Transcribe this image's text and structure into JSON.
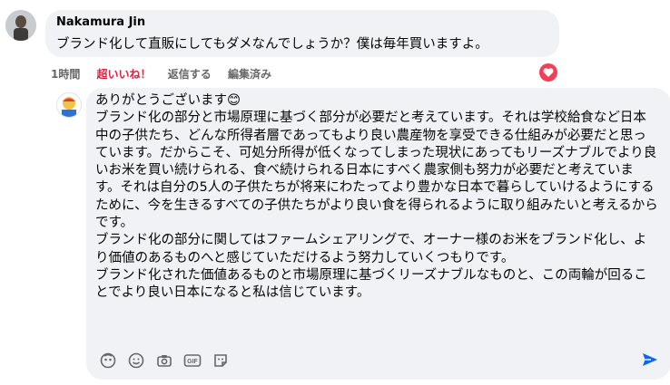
{
  "comment": {
    "author": "Nakamura Jin",
    "text": "ブランド化して直販にしてもダメなんでしょうか？僕は毎年買いますよ。",
    "time": "1時間",
    "like_label": "超いいね！",
    "reply_label": "返信する",
    "edited_label": "編集済み"
  },
  "reply_draft": {
    "text": "ありがとうございます😊\nブランド化の部分と市場原理に基づく部分が必要だと考えています。それは学校給食など日本中の子供たち、どんな所得者層であってもより良い農産物を享受できる仕組みが必要だと思っています。だからこそ、可処分所得が低くなってしまった現状にあってもリーズナブルでより良いお米を買い続けられる、食べ続けられる日本にすべく農家側も努力が必要だと考えています。それは自分の5人の子供たちが将来にわたってより豊かな日本で暮らしていけるようにするために、今を生きるすべての子供たちがより良い食を得られるように取り組みたいと考えるからです。\nブランド化の部分に関してはファームシェアリングで、オーナー様のお米をブランド化し、より価値のあるものへと感じていただけるよう努力していくつもりです。\nブランド化された価値あるものと市場原理に基づくリーズナブルなものと、この両輪が回ることでより良い日本になると私は信じています。"
  },
  "toolbar": {
    "gif_label": "GIF",
    "icons": [
      "avatar-sticker-icon",
      "emoji-icon",
      "camera-icon",
      "gif-icon",
      "sticker-icon",
      "send-icon"
    ]
  },
  "colors": {
    "liked": "#e41e3f",
    "send": "#0866ff",
    "bubble": "#f0f2f5",
    "muted": "#65676b"
  }
}
